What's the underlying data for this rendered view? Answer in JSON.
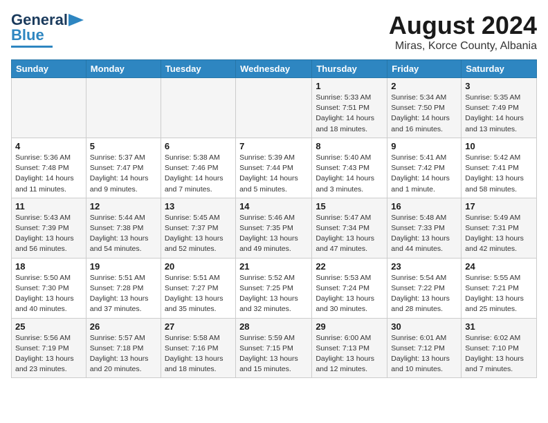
{
  "header": {
    "logo_line1": "General",
    "logo_line2": "Blue",
    "title": "August 2024",
    "subtitle": "Miras, Korce County, Albania"
  },
  "weekdays": [
    "Sunday",
    "Monday",
    "Tuesday",
    "Wednesday",
    "Thursday",
    "Friday",
    "Saturday"
  ],
  "weeks": [
    [
      {
        "day": "",
        "detail": ""
      },
      {
        "day": "",
        "detail": ""
      },
      {
        "day": "",
        "detail": ""
      },
      {
        "day": "",
        "detail": ""
      },
      {
        "day": "1",
        "detail": "Sunrise: 5:33 AM\nSunset: 7:51 PM\nDaylight: 14 hours\nand 18 minutes."
      },
      {
        "day": "2",
        "detail": "Sunrise: 5:34 AM\nSunset: 7:50 PM\nDaylight: 14 hours\nand 16 minutes."
      },
      {
        "day": "3",
        "detail": "Sunrise: 5:35 AM\nSunset: 7:49 PM\nDaylight: 14 hours\nand 13 minutes."
      }
    ],
    [
      {
        "day": "4",
        "detail": "Sunrise: 5:36 AM\nSunset: 7:48 PM\nDaylight: 14 hours\nand 11 minutes."
      },
      {
        "day": "5",
        "detail": "Sunrise: 5:37 AM\nSunset: 7:47 PM\nDaylight: 14 hours\nand 9 minutes."
      },
      {
        "day": "6",
        "detail": "Sunrise: 5:38 AM\nSunset: 7:46 PM\nDaylight: 14 hours\nand 7 minutes."
      },
      {
        "day": "7",
        "detail": "Sunrise: 5:39 AM\nSunset: 7:44 PM\nDaylight: 14 hours\nand 5 minutes."
      },
      {
        "day": "8",
        "detail": "Sunrise: 5:40 AM\nSunset: 7:43 PM\nDaylight: 14 hours\nand 3 minutes."
      },
      {
        "day": "9",
        "detail": "Sunrise: 5:41 AM\nSunset: 7:42 PM\nDaylight: 14 hours\nand 1 minute."
      },
      {
        "day": "10",
        "detail": "Sunrise: 5:42 AM\nSunset: 7:41 PM\nDaylight: 13 hours\nand 58 minutes."
      }
    ],
    [
      {
        "day": "11",
        "detail": "Sunrise: 5:43 AM\nSunset: 7:39 PM\nDaylight: 13 hours\nand 56 minutes."
      },
      {
        "day": "12",
        "detail": "Sunrise: 5:44 AM\nSunset: 7:38 PM\nDaylight: 13 hours\nand 54 minutes."
      },
      {
        "day": "13",
        "detail": "Sunrise: 5:45 AM\nSunset: 7:37 PM\nDaylight: 13 hours\nand 52 minutes."
      },
      {
        "day": "14",
        "detail": "Sunrise: 5:46 AM\nSunset: 7:35 PM\nDaylight: 13 hours\nand 49 minutes."
      },
      {
        "day": "15",
        "detail": "Sunrise: 5:47 AM\nSunset: 7:34 PM\nDaylight: 13 hours\nand 47 minutes."
      },
      {
        "day": "16",
        "detail": "Sunrise: 5:48 AM\nSunset: 7:33 PM\nDaylight: 13 hours\nand 44 minutes."
      },
      {
        "day": "17",
        "detail": "Sunrise: 5:49 AM\nSunset: 7:31 PM\nDaylight: 13 hours\nand 42 minutes."
      }
    ],
    [
      {
        "day": "18",
        "detail": "Sunrise: 5:50 AM\nSunset: 7:30 PM\nDaylight: 13 hours\nand 40 minutes."
      },
      {
        "day": "19",
        "detail": "Sunrise: 5:51 AM\nSunset: 7:28 PM\nDaylight: 13 hours\nand 37 minutes."
      },
      {
        "day": "20",
        "detail": "Sunrise: 5:51 AM\nSunset: 7:27 PM\nDaylight: 13 hours\nand 35 minutes."
      },
      {
        "day": "21",
        "detail": "Sunrise: 5:52 AM\nSunset: 7:25 PM\nDaylight: 13 hours\nand 32 minutes."
      },
      {
        "day": "22",
        "detail": "Sunrise: 5:53 AM\nSunset: 7:24 PM\nDaylight: 13 hours\nand 30 minutes."
      },
      {
        "day": "23",
        "detail": "Sunrise: 5:54 AM\nSunset: 7:22 PM\nDaylight: 13 hours\nand 28 minutes."
      },
      {
        "day": "24",
        "detail": "Sunrise: 5:55 AM\nSunset: 7:21 PM\nDaylight: 13 hours\nand 25 minutes."
      }
    ],
    [
      {
        "day": "25",
        "detail": "Sunrise: 5:56 AM\nSunset: 7:19 PM\nDaylight: 13 hours\nand 23 minutes."
      },
      {
        "day": "26",
        "detail": "Sunrise: 5:57 AM\nSunset: 7:18 PM\nDaylight: 13 hours\nand 20 minutes."
      },
      {
        "day": "27",
        "detail": "Sunrise: 5:58 AM\nSunset: 7:16 PM\nDaylight: 13 hours\nand 18 minutes."
      },
      {
        "day": "28",
        "detail": "Sunrise: 5:59 AM\nSunset: 7:15 PM\nDaylight: 13 hours\nand 15 minutes."
      },
      {
        "day": "29",
        "detail": "Sunrise: 6:00 AM\nSunset: 7:13 PM\nDaylight: 13 hours\nand 12 minutes."
      },
      {
        "day": "30",
        "detail": "Sunrise: 6:01 AM\nSunset: 7:12 PM\nDaylight: 13 hours\nand 10 minutes."
      },
      {
        "day": "31",
        "detail": "Sunrise: 6:02 AM\nSunset: 7:10 PM\nDaylight: 13 hours\nand 7 minutes."
      }
    ]
  ]
}
